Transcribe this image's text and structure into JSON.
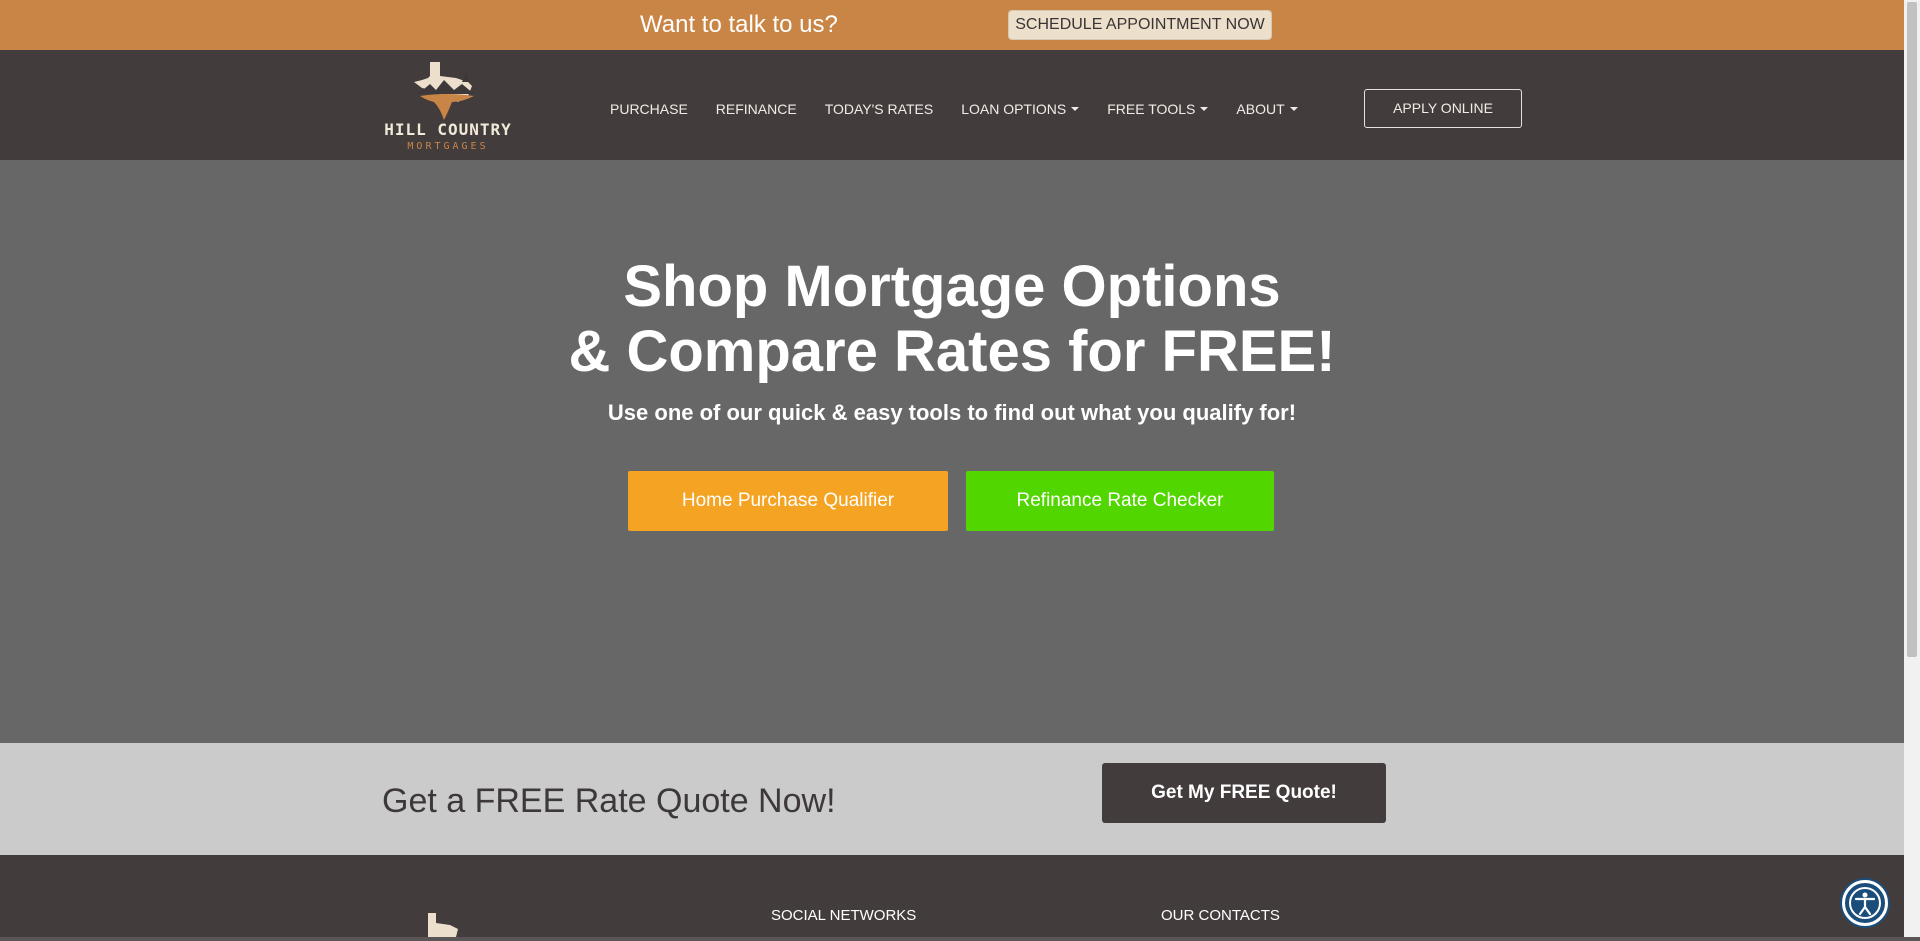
{
  "topbar": {
    "prompt": "Want to talk to us?",
    "schedule_label": "SCHEDULE APPOINTMENT NOW"
  },
  "header": {
    "logo_title": "HILL COUNTRY",
    "logo_sub": "MORTGAGES",
    "nav": [
      {
        "label": "PURCHASE",
        "dropdown": false
      },
      {
        "label": "REFINANCE",
        "dropdown": false
      },
      {
        "label": "TODAY'S RATES",
        "dropdown": false
      },
      {
        "label": "LOAN OPTIONS",
        "dropdown": true
      },
      {
        "label": "FREE TOOLS",
        "dropdown": true
      },
      {
        "label": "ABOUT",
        "dropdown": true
      }
    ],
    "apply_label": "APPLY ONLINE"
  },
  "hero": {
    "title_line1": "Shop Mortgage Options",
    "title_line2": "& Compare Rates for FREE!",
    "subtitle": "Use one of our quick & easy tools to find out what you qualify for!",
    "purchase_button": "Home Purchase Qualifier",
    "refinance_button": "Refinance Rate Checker"
  },
  "quote": {
    "text": "Get a FREE Rate Quote Now!",
    "button": "Get My FREE Quote!"
  },
  "footer": {
    "social_heading": "SOCIAL NETWORKS",
    "contacts_heading": "OUR CONTACTS"
  },
  "colors": {
    "topbar": "#c98546",
    "navbar": "#433c3d",
    "hero": "#676767",
    "purchase": "#f5a322",
    "refinance": "#52d600",
    "quote_band": "#cbcbcb"
  }
}
